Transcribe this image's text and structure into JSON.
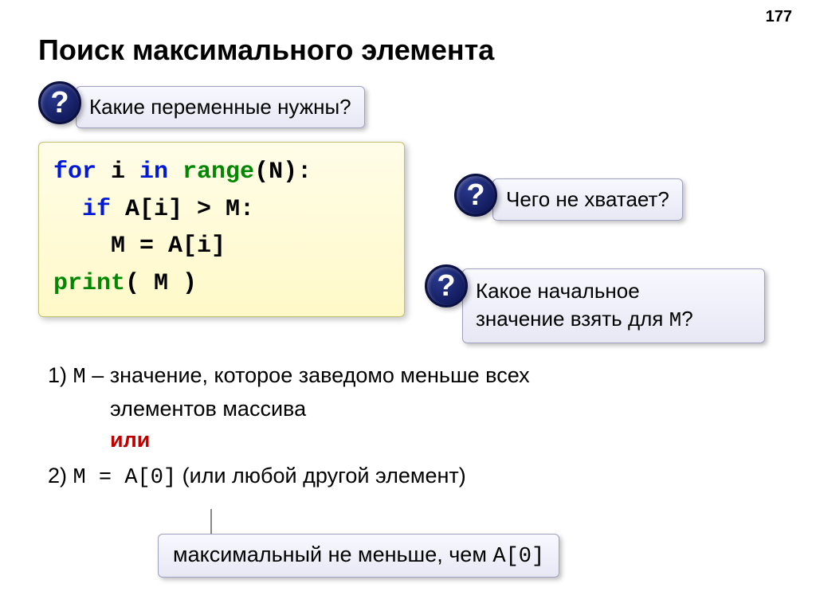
{
  "pageNumber": "177",
  "title": "Поиск максимального элемента",
  "callout1": "Какие переменные нужны?",
  "callout2": "Чего не хватает?",
  "callout3_a": "Какое начальное",
  "callout3_b": "значение взять для ",
  "callout3_m": "М",
  "callout3_q": "?",
  "code": {
    "l1_a": "for ",
    "l1_b": "i ",
    "l1_c": "in ",
    "l1_d": "range",
    "l1_e": "(N):",
    "l2_a": "  if",
    "l2_b": " A[i] > M:",
    "l3": "    M = A[i]",
    "l4_a": "print",
    "l4_b": "( M )"
  },
  "notes": {
    "p1_a": "1)  ",
    "p1_m": "M",
    "p1_b": " – значение, которое заведомо меньше всех",
    "p1_c": "элементов массива",
    "or": "или",
    "p2_a": "2) ",
    "p2_code": "M = A[0]",
    "p2_b": " (или любой другой элемент)"
  },
  "bottom": {
    "a": "максимальный не меньше, чем ",
    "code": "A[0]"
  },
  "qmark": "?"
}
